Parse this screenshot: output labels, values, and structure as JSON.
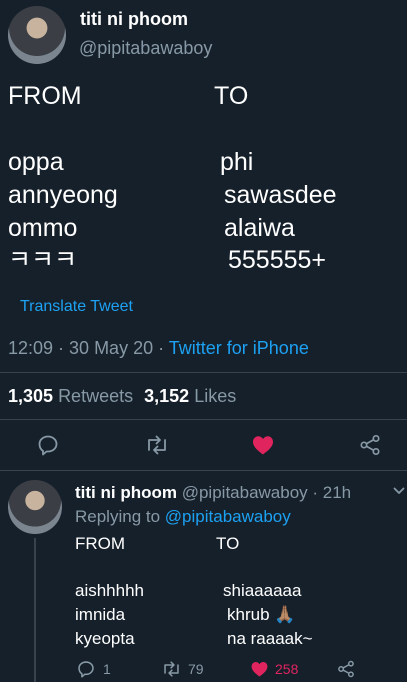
{
  "tweet": {
    "display_name": "titi ni phoom",
    "handle": "@pipitabawaboy",
    "header_from": "FROM",
    "header_to": "TO",
    "from_words": [
      "oppa",
      "annyeong",
      "ommo",
      "ㅋㅋㅋ"
    ],
    "to_words": [
      "phi",
      "sawasdee",
      "alaiwa",
      "555555+"
    ],
    "translate_label": "Translate Tweet",
    "timestamp": "12:09 · 30 May 20 ·",
    "source": "Twitter for iPhone",
    "retweets_count": "1,305",
    "retweets_label": "Retweets",
    "likes_count": "3,152",
    "likes_label": "Likes"
  },
  "reply": {
    "display_name": "titi ni phoom",
    "handle_time": "@pipitabawaboy · 21h",
    "replying_prefix": "Replying to",
    "replying_handle": "@pipitabawaboy",
    "header_from": "FROM",
    "header_to": "TO",
    "from_words": [
      "aishhhhh",
      "imnida",
      "kyeopta"
    ],
    "to_words": [
      "shiaaaaaa",
      "khrub 🙏🏽",
      "na raaaak~"
    ],
    "reply_count": "1",
    "retweet_count": "79",
    "like_count": "258"
  },
  "colors": {
    "background": "#15202b",
    "accent": "#1da1f2",
    "like": "#e0245e",
    "muted": "#8899a6",
    "divider": "#38444d"
  },
  "icons": [
    "reply-icon",
    "retweet-icon",
    "heart-icon",
    "share-icon",
    "chevron-down-icon"
  ]
}
